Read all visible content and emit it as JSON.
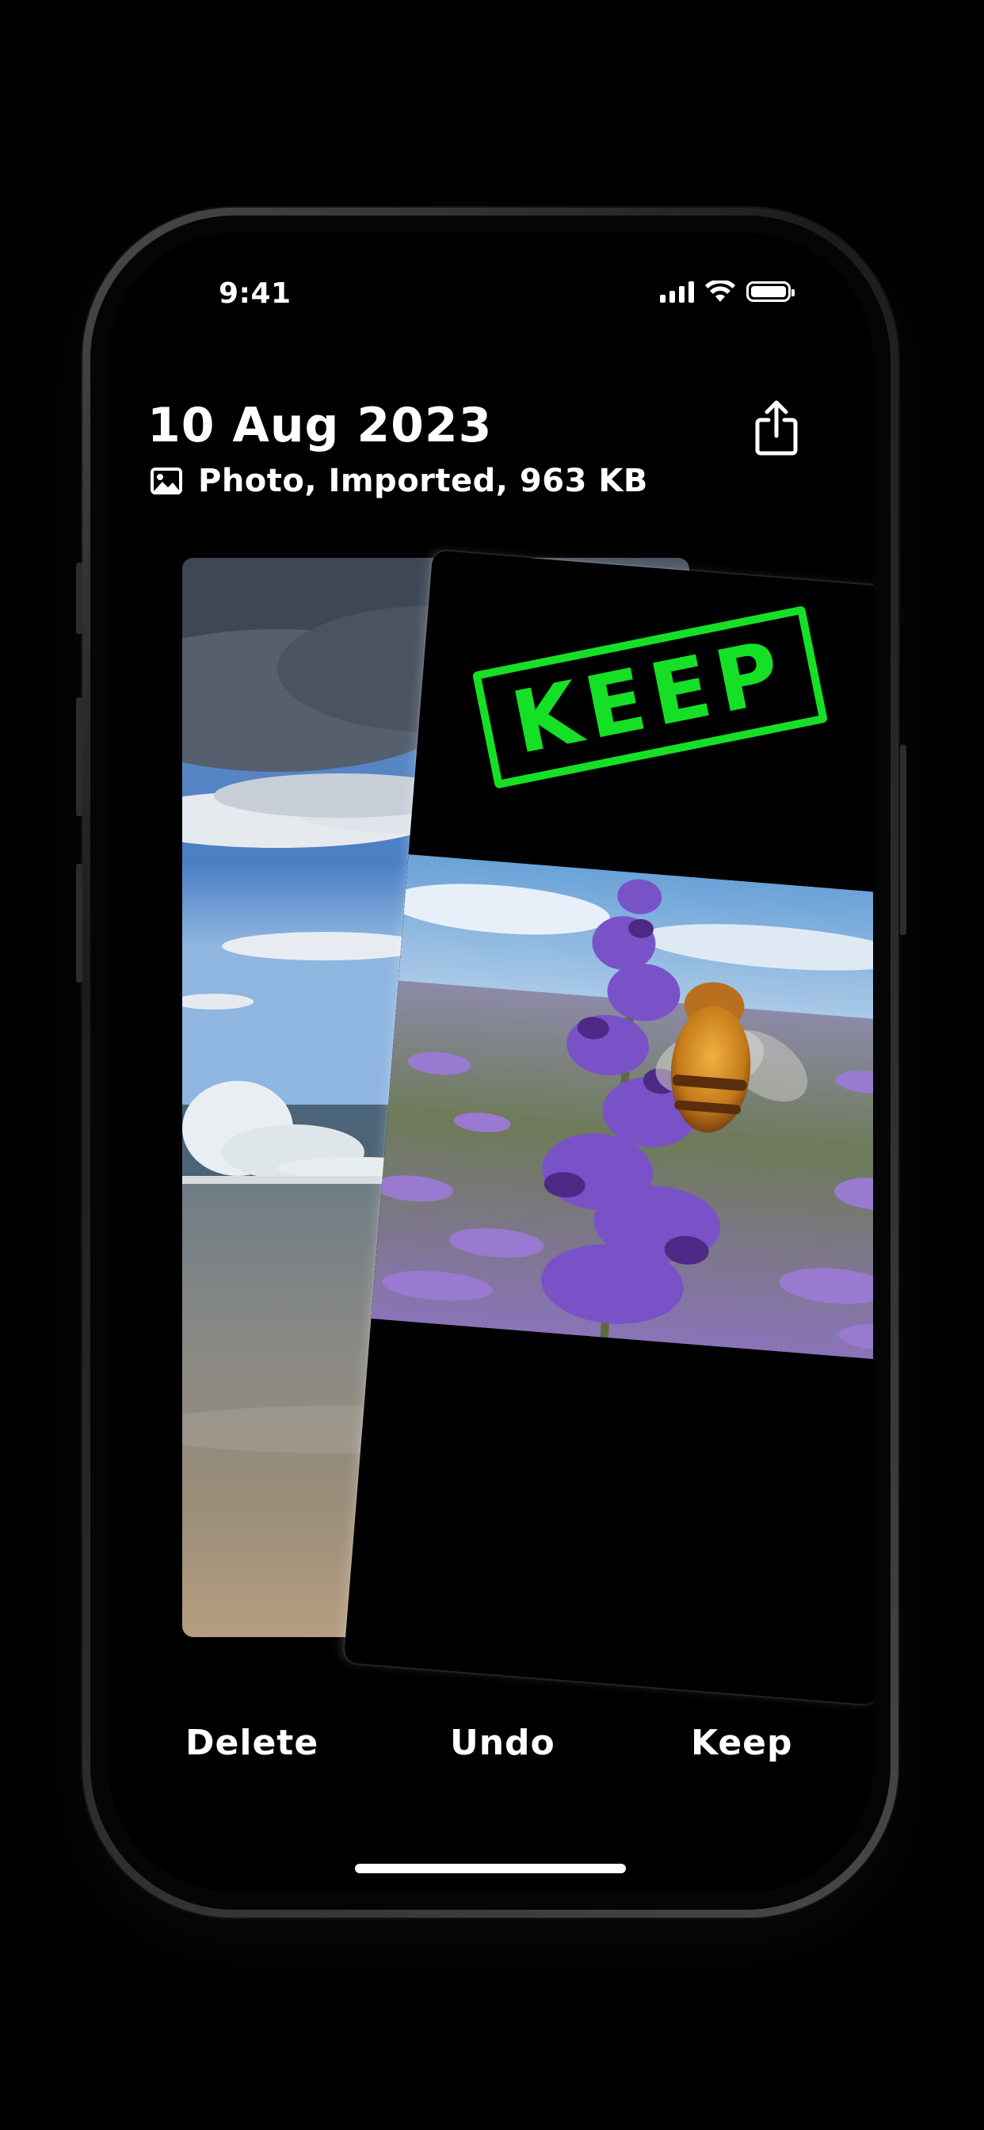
{
  "status_bar": {
    "time": "9:41"
  },
  "header": {
    "date": "10 Aug 2023",
    "meta": "Photo, Imported, 963 KB"
  },
  "icons": {
    "photo": "photo-icon",
    "share": "share-icon",
    "signal": "cellular-signal-icon",
    "wifi": "wifi-icon",
    "battery": "battery-icon"
  },
  "stamp": {
    "label": "KEEP",
    "color": "#16e025"
  },
  "actions": {
    "delete": "Delete",
    "undo": "Undo",
    "keep": "Keep"
  }
}
